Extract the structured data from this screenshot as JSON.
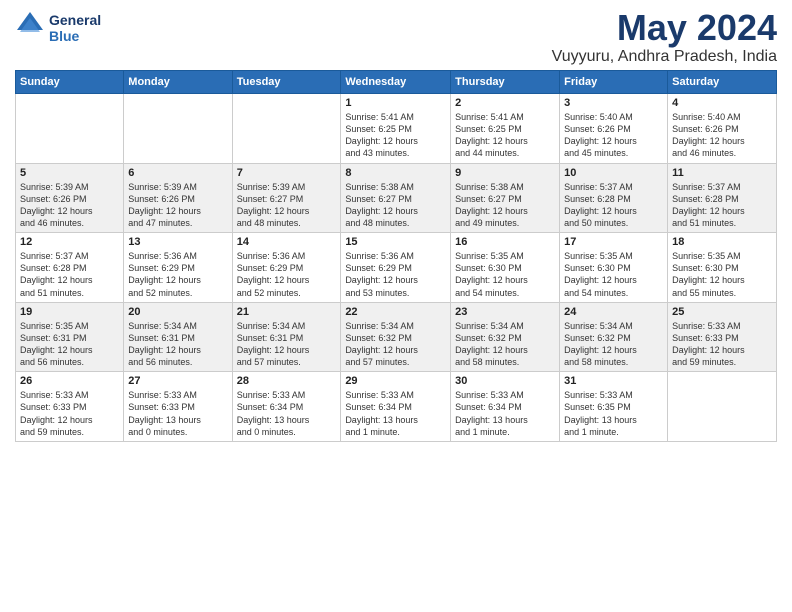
{
  "header": {
    "logo_line1": "General",
    "logo_line2": "Blue",
    "title": "May 2024",
    "location": "Vuyyuru, Andhra Pradesh, India"
  },
  "days_of_week": [
    "Sunday",
    "Monday",
    "Tuesday",
    "Wednesday",
    "Thursday",
    "Friday",
    "Saturday"
  ],
  "weeks": [
    [
      {
        "day": "",
        "info": ""
      },
      {
        "day": "",
        "info": ""
      },
      {
        "day": "",
        "info": ""
      },
      {
        "day": "1",
        "info": "Sunrise: 5:41 AM\nSunset: 6:25 PM\nDaylight: 12 hours\nand 43 minutes."
      },
      {
        "day": "2",
        "info": "Sunrise: 5:41 AM\nSunset: 6:25 PM\nDaylight: 12 hours\nand 44 minutes."
      },
      {
        "day": "3",
        "info": "Sunrise: 5:40 AM\nSunset: 6:26 PM\nDaylight: 12 hours\nand 45 minutes."
      },
      {
        "day": "4",
        "info": "Sunrise: 5:40 AM\nSunset: 6:26 PM\nDaylight: 12 hours\nand 46 minutes."
      }
    ],
    [
      {
        "day": "5",
        "info": "Sunrise: 5:39 AM\nSunset: 6:26 PM\nDaylight: 12 hours\nand 46 minutes."
      },
      {
        "day": "6",
        "info": "Sunrise: 5:39 AM\nSunset: 6:26 PM\nDaylight: 12 hours\nand 47 minutes."
      },
      {
        "day": "7",
        "info": "Sunrise: 5:39 AM\nSunset: 6:27 PM\nDaylight: 12 hours\nand 48 minutes."
      },
      {
        "day": "8",
        "info": "Sunrise: 5:38 AM\nSunset: 6:27 PM\nDaylight: 12 hours\nand 48 minutes."
      },
      {
        "day": "9",
        "info": "Sunrise: 5:38 AM\nSunset: 6:27 PM\nDaylight: 12 hours\nand 49 minutes."
      },
      {
        "day": "10",
        "info": "Sunrise: 5:37 AM\nSunset: 6:28 PM\nDaylight: 12 hours\nand 50 minutes."
      },
      {
        "day": "11",
        "info": "Sunrise: 5:37 AM\nSunset: 6:28 PM\nDaylight: 12 hours\nand 51 minutes."
      }
    ],
    [
      {
        "day": "12",
        "info": "Sunrise: 5:37 AM\nSunset: 6:28 PM\nDaylight: 12 hours\nand 51 minutes."
      },
      {
        "day": "13",
        "info": "Sunrise: 5:36 AM\nSunset: 6:29 PM\nDaylight: 12 hours\nand 52 minutes."
      },
      {
        "day": "14",
        "info": "Sunrise: 5:36 AM\nSunset: 6:29 PM\nDaylight: 12 hours\nand 52 minutes."
      },
      {
        "day": "15",
        "info": "Sunrise: 5:36 AM\nSunset: 6:29 PM\nDaylight: 12 hours\nand 53 minutes."
      },
      {
        "day": "16",
        "info": "Sunrise: 5:35 AM\nSunset: 6:30 PM\nDaylight: 12 hours\nand 54 minutes."
      },
      {
        "day": "17",
        "info": "Sunrise: 5:35 AM\nSunset: 6:30 PM\nDaylight: 12 hours\nand 54 minutes."
      },
      {
        "day": "18",
        "info": "Sunrise: 5:35 AM\nSunset: 6:30 PM\nDaylight: 12 hours\nand 55 minutes."
      }
    ],
    [
      {
        "day": "19",
        "info": "Sunrise: 5:35 AM\nSunset: 6:31 PM\nDaylight: 12 hours\nand 56 minutes."
      },
      {
        "day": "20",
        "info": "Sunrise: 5:34 AM\nSunset: 6:31 PM\nDaylight: 12 hours\nand 56 minutes."
      },
      {
        "day": "21",
        "info": "Sunrise: 5:34 AM\nSunset: 6:31 PM\nDaylight: 12 hours\nand 57 minutes."
      },
      {
        "day": "22",
        "info": "Sunrise: 5:34 AM\nSunset: 6:32 PM\nDaylight: 12 hours\nand 57 minutes."
      },
      {
        "day": "23",
        "info": "Sunrise: 5:34 AM\nSunset: 6:32 PM\nDaylight: 12 hours\nand 58 minutes."
      },
      {
        "day": "24",
        "info": "Sunrise: 5:34 AM\nSunset: 6:32 PM\nDaylight: 12 hours\nand 58 minutes."
      },
      {
        "day": "25",
        "info": "Sunrise: 5:33 AM\nSunset: 6:33 PM\nDaylight: 12 hours\nand 59 minutes."
      }
    ],
    [
      {
        "day": "26",
        "info": "Sunrise: 5:33 AM\nSunset: 6:33 PM\nDaylight: 12 hours\nand 59 minutes."
      },
      {
        "day": "27",
        "info": "Sunrise: 5:33 AM\nSunset: 6:33 PM\nDaylight: 13 hours\nand 0 minutes."
      },
      {
        "day": "28",
        "info": "Sunrise: 5:33 AM\nSunset: 6:34 PM\nDaylight: 13 hours\nand 0 minutes."
      },
      {
        "day": "29",
        "info": "Sunrise: 5:33 AM\nSunset: 6:34 PM\nDaylight: 13 hours\nand 1 minute."
      },
      {
        "day": "30",
        "info": "Sunrise: 5:33 AM\nSunset: 6:34 PM\nDaylight: 13 hours\nand 1 minute."
      },
      {
        "day": "31",
        "info": "Sunrise: 5:33 AM\nSunset: 6:35 PM\nDaylight: 13 hours\nand 1 minute."
      },
      {
        "day": "",
        "info": ""
      }
    ]
  ]
}
